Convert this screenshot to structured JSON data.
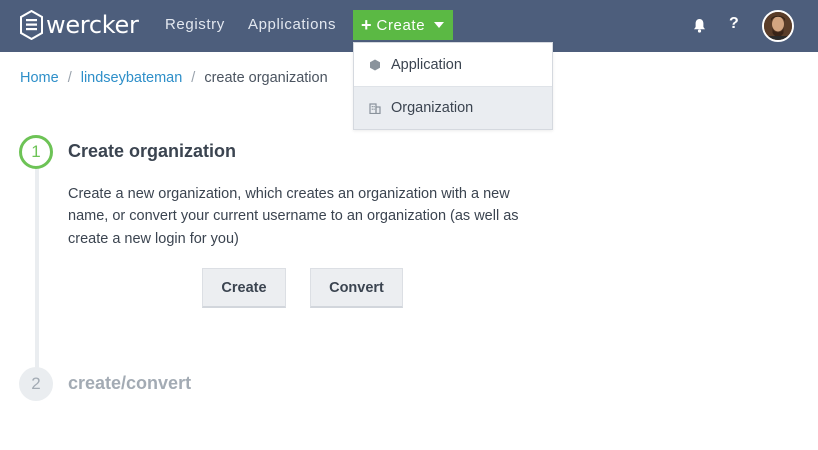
{
  "header": {
    "brand": "wercker",
    "nav": [
      "Registry",
      "Applications"
    ],
    "create_label": "Create",
    "help_label": "?",
    "icons": {
      "brand": "wercker-logo-icon",
      "notifications": "bell-icon",
      "help": "help-icon",
      "user": "avatar"
    }
  },
  "create_menu": {
    "items": [
      {
        "label": "Application",
        "icon": "hexagon-icon"
      },
      {
        "label": "Organization",
        "icon": "building-icon"
      }
    ]
  },
  "breadcrumb": {
    "home": "Home",
    "user": "lindseybateman",
    "current": "create organization",
    "separator": "/"
  },
  "steps": [
    {
      "number": "1",
      "title": "Create organization",
      "description": "Create a new organization, which creates an organization with a new name, or convert your current username to an organization (as well as create a new login for you)",
      "buttons": [
        "Create",
        "Convert"
      ]
    },
    {
      "number": "2",
      "title": "create/convert"
    }
  ],
  "colors": {
    "header_bg": "#4d5e7c",
    "accent_green": "#5bb944",
    "link_blue": "#2e8fc9",
    "menu_highlight": "#eaedf1"
  }
}
